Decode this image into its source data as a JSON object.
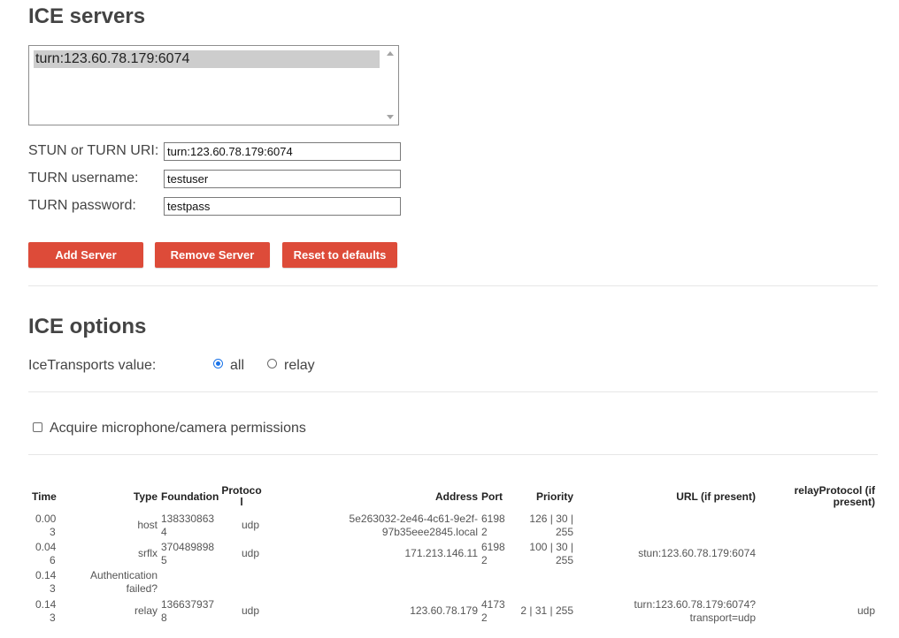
{
  "ice_servers": {
    "title": "ICE servers",
    "list_items": [
      "turn:123.60.78.179:6074"
    ],
    "uri_label": "STUN or TURN URI:",
    "uri_value": "turn:123.60.78.179:6074",
    "username_label": "TURN username:",
    "username_value": "testuser",
    "password_label": "TURN password:",
    "password_value": "testpass",
    "add_button": "Add Server",
    "remove_button": "Remove Server",
    "reset_button": "Reset to defaults"
  },
  "ice_options": {
    "title": "ICE options",
    "transports_label": "IceTransports value:",
    "option_all": "all",
    "option_relay": "relay",
    "selected": "all",
    "acquire_label": "Acquire microphone/camera permissions",
    "acquire_checked": false
  },
  "table": {
    "headers": {
      "time": "Time",
      "type": "Type",
      "foundation": "Foundation",
      "protocol_1": "Protoco",
      "protocol_2": "l",
      "address": "Address",
      "port": "Port",
      "priority": "Priority",
      "url": "URL (if present)",
      "relay_1": "relayProtocol (if",
      "relay_2": "present)"
    },
    "rows": [
      {
        "time_1": "0.00",
        "time_2": "3",
        "type": "host",
        "foundation_1": "138330863",
        "foundation_2": "4",
        "protocol": "udp",
        "address_1": "5e263032-2e46-4c61-9e2f-",
        "address_2": "97b35eee2845.local",
        "port_1": "6198",
        "port_2": "2",
        "priority_1": "126 | 30 |",
        "priority_2": "255",
        "url_1": "",
        "url_2": "",
        "relay": ""
      },
      {
        "time_1": "0.04",
        "time_2": "6",
        "type": "srflx",
        "foundation_1": "370489898",
        "foundation_2": "5",
        "protocol": "udp",
        "address_1": "171.213.146.11",
        "address_2": "",
        "port_1": "6198",
        "port_2": "2",
        "priority_1": "100 | 30 |",
        "priority_2": "255",
        "url_1": "stun:123.60.78.179:6074",
        "url_2": "",
        "relay": ""
      },
      {
        "time_1": "0.14",
        "time_2": "3",
        "type_1": "Authentication",
        "type_2": "failed?"
      },
      {
        "time_1": "0.14",
        "time_2": "3",
        "type": "relay",
        "foundation_1": "136637937",
        "foundation_2": "8",
        "protocol": "udp",
        "address_1": "123.60.78.179",
        "address_2": "",
        "port_1": "4173",
        "port_2": "2",
        "priority_1": "2 | 31 | 255",
        "priority_2": "",
        "url_1": "turn:123.60.78.179:6074?",
        "url_2": "transport=udp",
        "relay": "udp"
      }
    ]
  },
  "colors": {
    "button": "#dd4b39",
    "radio_selected": "#1a73e8",
    "divider": "#e6e6e6"
  }
}
